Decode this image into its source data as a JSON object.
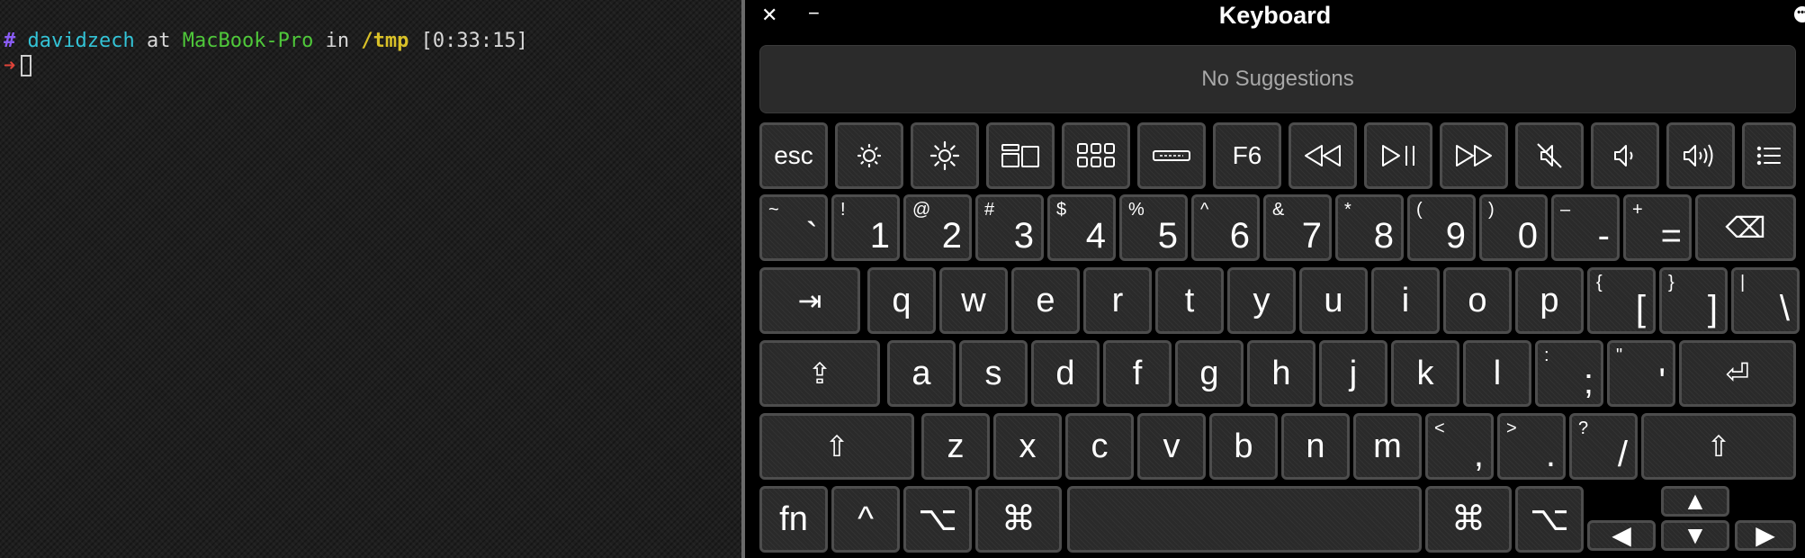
{
  "terminal": {
    "hash": "#",
    "user": "davidzech",
    "at": "at",
    "host": "MacBook-Pro",
    "in": "in",
    "dir": "/tmp",
    "time": "[0:33:15]",
    "arrow": "➜"
  },
  "keyboard": {
    "title": "Keyboard",
    "close": "✕",
    "minimize": "−",
    "more": "•••",
    "suggestions": "No Suggestions",
    "function_row": [
      {
        "label": "esc",
        "icon": null
      },
      {
        "label": "",
        "icon": "brightness-down-icon"
      },
      {
        "label": "",
        "icon": "brightness-up-icon"
      },
      {
        "label": "",
        "icon": "mission-control-icon"
      },
      {
        "label": "",
        "icon": "launchpad-icon"
      },
      {
        "label": "",
        "icon": "keyboard-light-icon"
      },
      {
        "label": "F6",
        "icon": null
      },
      {
        "label": "",
        "icon": "rewind-icon"
      },
      {
        "label": "",
        "icon": "play-pause-icon"
      },
      {
        "label": "",
        "icon": "fast-forward-icon"
      },
      {
        "label": "",
        "icon": "mute-icon"
      },
      {
        "label": "",
        "icon": "volume-down-icon"
      },
      {
        "label": "",
        "icon": "volume-up-icon"
      },
      {
        "label": "",
        "icon": "list-icon"
      }
    ],
    "number_row": [
      {
        "top": "~",
        "main": "`"
      },
      {
        "top": "!",
        "main": "1"
      },
      {
        "top": "@",
        "main": "2"
      },
      {
        "top": "#",
        "main": "3"
      },
      {
        "top": "$",
        "main": "4"
      },
      {
        "top": "%",
        "main": "5"
      },
      {
        "top": "^",
        "main": "6"
      },
      {
        "top": "&",
        "main": "7"
      },
      {
        "top": "*",
        "main": "8"
      },
      {
        "top": "(",
        "main": "9"
      },
      {
        "top": ")",
        "main": "0"
      },
      {
        "top": "–",
        "main": "-"
      },
      {
        "top": "+",
        "main": "="
      }
    ],
    "delete": "⌫",
    "tab": "⇥",
    "row_q": [
      "q",
      "w",
      "e",
      "r",
      "t",
      "y",
      "u",
      "i",
      "o",
      "p"
    ],
    "row_q_sym": [
      {
        "top": "{",
        "main": "["
      },
      {
        "top": "}",
        "main": "]"
      },
      {
        "top": "|",
        "main": "\\"
      }
    ],
    "caps": "⇪",
    "row_a": [
      "a",
      "s",
      "d",
      "f",
      "g",
      "h",
      "j",
      "k",
      "l"
    ],
    "row_a_sym": [
      {
        "top": ":",
        "main": ";"
      },
      {
        "top": "\"",
        "main": "'"
      }
    ],
    "return": "⏎",
    "shift": "⇧",
    "row_z": [
      "z",
      "x",
      "c",
      "v",
      "b",
      "n",
      "m"
    ],
    "row_z_sym": [
      {
        "top": "<",
        "main": ","
      },
      {
        "top": ">",
        "main": "."
      },
      {
        "top": "?",
        "main": "/"
      }
    ],
    "fn": "fn",
    "control": "^",
    "option": "⌥",
    "command": "⌘",
    "arrow_up": "▲",
    "arrow_left": "◀",
    "arrow_down": "▼",
    "arrow_right": "▶"
  }
}
